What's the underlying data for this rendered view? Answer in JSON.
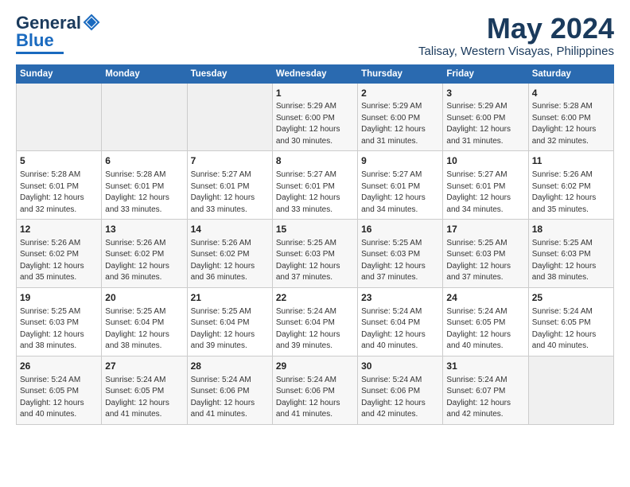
{
  "header": {
    "logo_general": "General",
    "logo_blue": "Blue",
    "month": "May 2024",
    "location": "Talisay, Western Visayas, Philippines"
  },
  "weekdays": [
    "Sunday",
    "Monday",
    "Tuesday",
    "Wednesday",
    "Thursday",
    "Friday",
    "Saturday"
  ],
  "weeks": [
    [
      {
        "day": "",
        "empty": true
      },
      {
        "day": "",
        "empty": true
      },
      {
        "day": "",
        "empty": true
      },
      {
        "day": "1",
        "sunrise": "5:29 AM",
        "sunset": "6:00 PM",
        "daylight": "12 hours and 30 minutes."
      },
      {
        "day": "2",
        "sunrise": "5:29 AM",
        "sunset": "6:00 PM",
        "daylight": "12 hours and 31 minutes."
      },
      {
        "day": "3",
        "sunrise": "5:29 AM",
        "sunset": "6:00 PM",
        "daylight": "12 hours and 31 minutes."
      },
      {
        "day": "4",
        "sunrise": "5:28 AM",
        "sunset": "6:00 PM",
        "daylight": "12 hours and 32 minutes."
      }
    ],
    [
      {
        "day": "5",
        "sunrise": "5:28 AM",
        "sunset": "6:01 PM",
        "daylight": "12 hours and 32 minutes."
      },
      {
        "day": "6",
        "sunrise": "5:28 AM",
        "sunset": "6:01 PM",
        "daylight": "12 hours and 33 minutes."
      },
      {
        "day": "7",
        "sunrise": "5:27 AM",
        "sunset": "6:01 PM",
        "daylight": "12 hours and 33 minutes."
      },
      {
        "day": "8",
        "sunrise": "5:27 AM",
        "sunset": "6:01 PM",
        "daylight": "12 hours and 33 minutes."
      },
      {
        "day": "9",
        "sunrise": "5:27 AM",
        "sunset": "6:01 PM",
        "daylight": "12 hours and 34 minutes."
      },
      {
        "day": "10",
        "sunrise": "5:27 AM",
        "sunset": "6:01 PM",
        "daylight": "12 hours and 34 minutes."
      },
      {
        "day": "11",
        "sunrise": "5:26 AM",
        "sunset": "6:02 PM",
        "daylight": "12 hours and 35 minutes."
      }
    ],
    [
      {
        "day": "12",
        "sunrise": "5:26 AM",
        "sunset": "6:02 PM",
        "daylight": "12 hours and 35 minutes."
      },
      {
        "day": "13",
        "sunrise": "5:26 AM",
        "sunset": "6:02 PM",
        "daylight": "12 hours and 36 minutes."
      },
      {
        "day": "14",
        "sunrise": "5:26 AM",
        "sunset": "6:02 PM",
        "daylight": "12 hours and 36 minutes."
      },
      {
        "day": "15",
        "sunrise": "5:25 AM",
        "sunset": "6:03 PM",
        "daylight": "12 hours and 37 minutes."
      },
      {
        "day": "16",
        "sunrise": "5:25 AM",
        "sunset": "6:03 PM",
        "daylight": "12 hours and 37 minutes."
      },
      {
        "day": "17",
        "sunrise": "5:25 AM",
        "sunset": "6:03 PM",
        "daylight": "12 hours and 37 minutes."
      },
      {
        "day": "18",
        "sunrise": "5:25 AM",
        "sunset": "6:03 PM",
        "daylight": "12 hours and 38 minutes."
      }
    ],
    [
      {
        "day": "19",
        "sunrise": "5:25 AM",
        "sunset": "6:03 PM",
        "daylight": "12 hours and 38 minutes."
      },
      {
        "day": "20",
        "sunrise": "5:25 AM",
        "sunset": "6:04 PM",
        "daylight": "12 hours and 38 minutes."
      },
      {
        "day": "21",
        "sunrise": "5:25 AM",
        "sunset": "6:04 PM",
        "daylight": "12 hours and 39 minutes."
      },
      {
        "day": "22",
        "sunrise": "5:24 AM",
        "sunset": "6:04 PM",
        "daylight": "12 hours and 39 minutes."
      },
      {
        "day": "23",
        "sunrise": "5:24 AM",
        "sunset": "6:04 PM",
        "daylight": "12 hours and 40 minutes."
      },
      {
        "day": "24",
        "sunrise": "5:24 AM",
        "sunset": "6:05 PM",
        "daylight": "12 hours and 40 minutes."
      },
      {
        "day": "25",
        "sunrise": "5:24 AM",
        "sunset": "6:05 PM",
        "daylight": "12 hours and 40 minutes."
      }
    ],
    [
      {
        "day": "26",
        "sunrise": "5:24 AM",
        "sunset": "6:05 PM",
        "daylight": "12 hours and 40 minutes."
      },
      {
        "day": "27",
        "sunrise": "5:24 AM",
        "sunset": "6:05 PM",
        "daylight": "12 hours and 41 minutes."
      },
      {
        "day": "28",
        "sunrise": "5:24 AM",
        "sunset": "6:06 PM",
        "daylight": "12 hours and 41 minutes."
      },
      {
        "day": "29",
        "sunrise": "5:24 AM",
        "sunset": "6:06 PM",
        "daylight": "12 hours and 41 minutes."
      },
      {
        "day": "30",
        "sunrise": "5:24 AM",
        "sunset": "6:06 PM",
        "daylight": "12 hours and 42 minutes."
      },
      {
        "day": "31",
        "sunrise": "5:24 AM",
        "sunset": "6:07 PM",
        "daylight": "12 hours and 42 minutes."
      },
      {
        "day": "",
        "empty": true
      }
    ]
  ]
}
